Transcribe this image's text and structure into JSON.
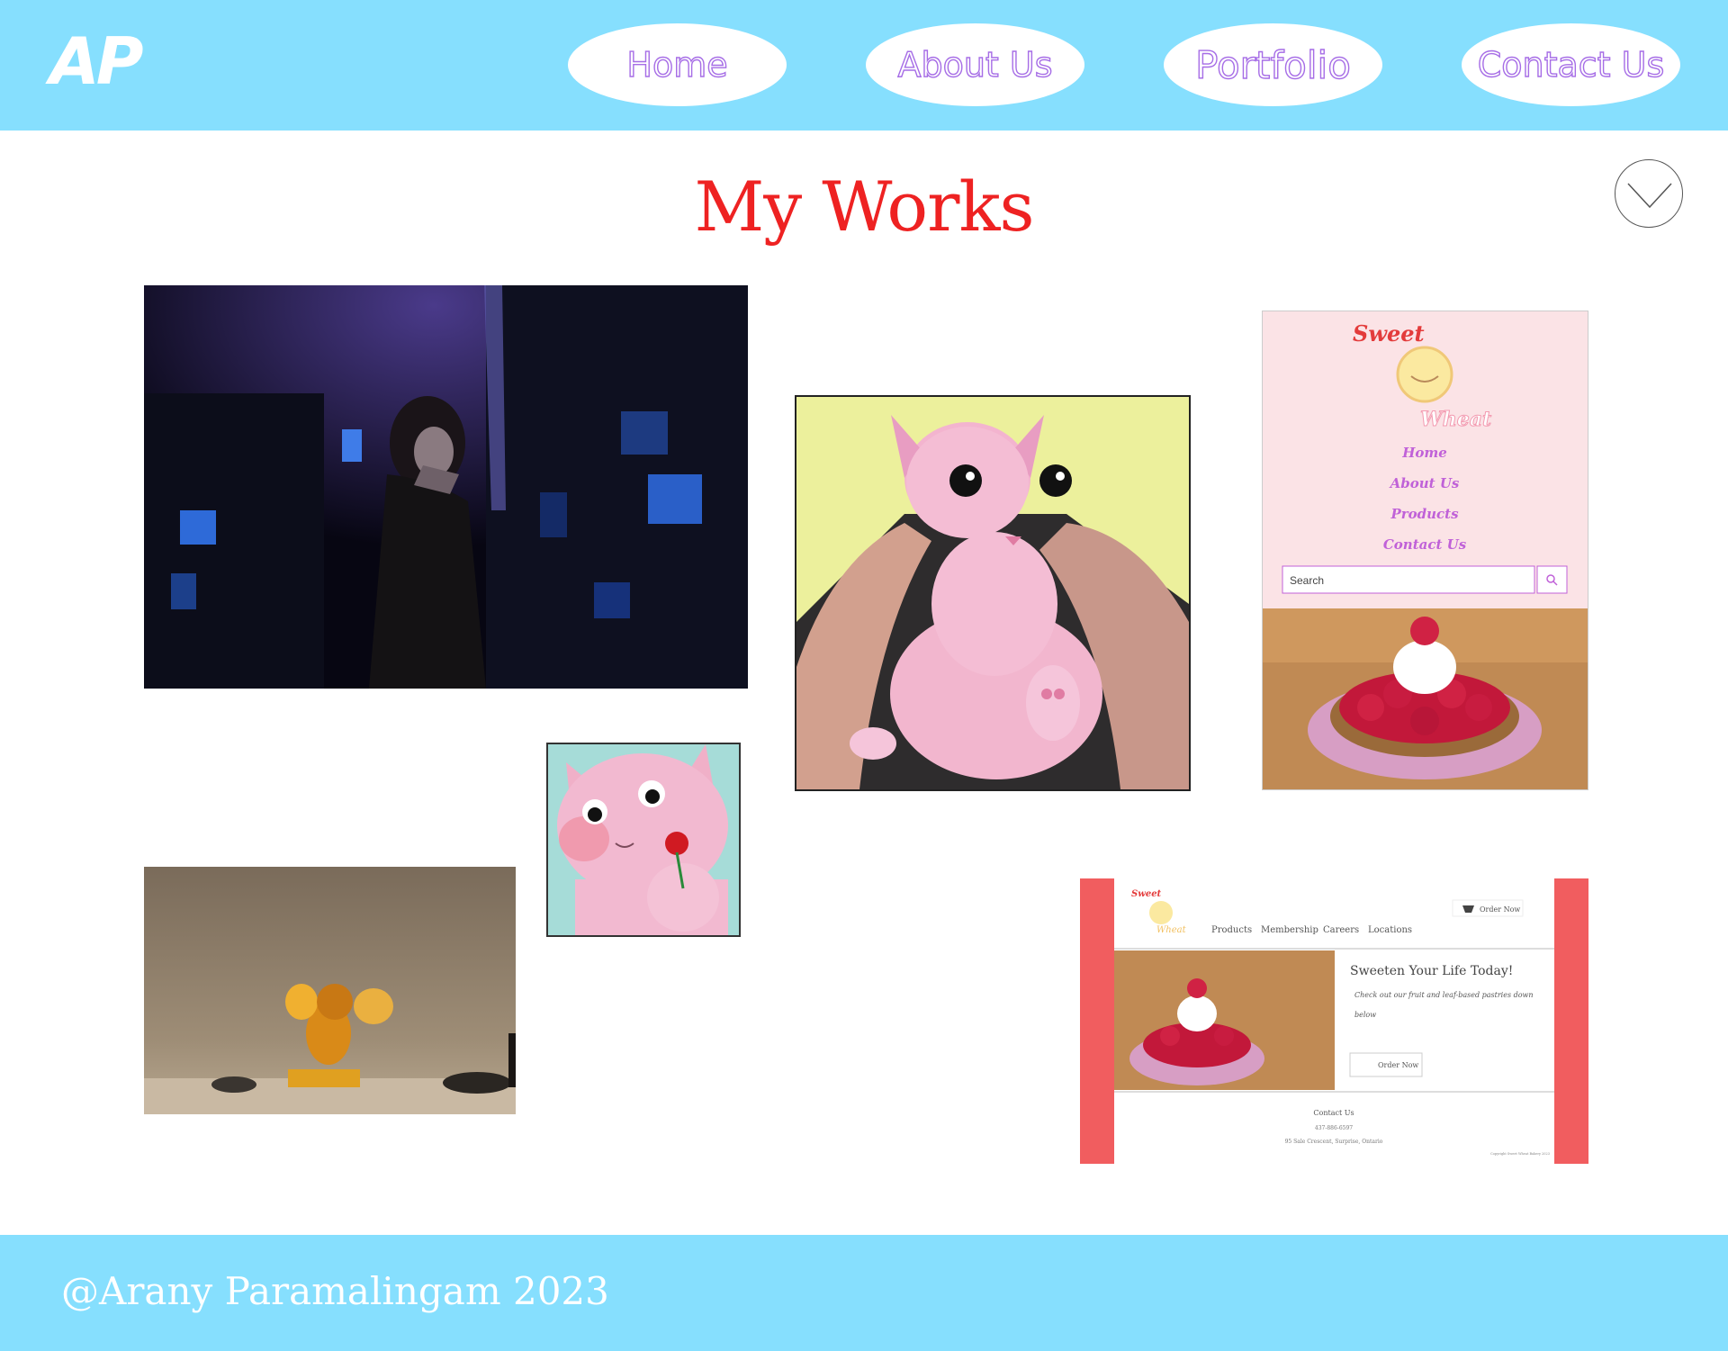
{
  "header": {
    "logo": "AP",
    "nav": [
      {
        "label": "Home"
      },
      {
        "label": "About Us"
      },
      {
        "label": "Portfolio"
      },
      {
        "label": "Contact Us"
      }
    ]
  },
  "main": {
    "title": "My Works",
    "works": [
      {
        "caption": "night street portrait photo"
      },
      {
        "caption": "pink cat illustration"
      },
      {
        "caption": "Sweet Wheat mobile site mockup"
      },
      {
        "caption": "cat with rose illustration"
      },
      {
        "caption": "amber mouse figurine photo"
      },
      {
        "caption": "Sweet Wheat desktop site mockup"
      }
    ]
  },
  "mobile_mock": {
    "brand_top": "Sweet",
    "brand_bottom": "Wheat",
    "nav": [
      "Home",
      "About Us",
      "Products",
      "Contact Us"
    ],
    "search_placeholder": "Search"
  },
  "desktop_mock": {
    "brand_top": "Sweet",
    "brand_bottom": "Wheat",
    "nav": [
      "Products",
      "Membership",
      "Careers",
      "Locations"
    ],
    "order_button": "Order Now",
    "headline": "Sweeten Your Life Today!",
    "subtext_1": "Check out our fruit and leaf-based pastries down",
    "subtext_2": "below",
    "cta": "Order Now",
    "contact_title": "Contact Us",
    "contact_phone": "437-886-6597",
    "contact_address": "95 Sale Crescent, Surprise, Ontario",
    "copyright": "Copyright Sweet Wheat Bakery 2023"
  },
  "footer": {
    "text": "@Arany Paramalingam 2023"
  },
  "colors": {
    "header_bg": "#86dffe",
    "title": "#ee2222",
    "nav_text": "#a66de6",
    "mock_red": "#f15d5f",
    "mock_pink_bg": "#fbe3e6"
  },
  "icons": {
    "scroll": "chevron-down-icon",
    "search": "search-icon",
    "cart": "cart-icon"
  }
}
